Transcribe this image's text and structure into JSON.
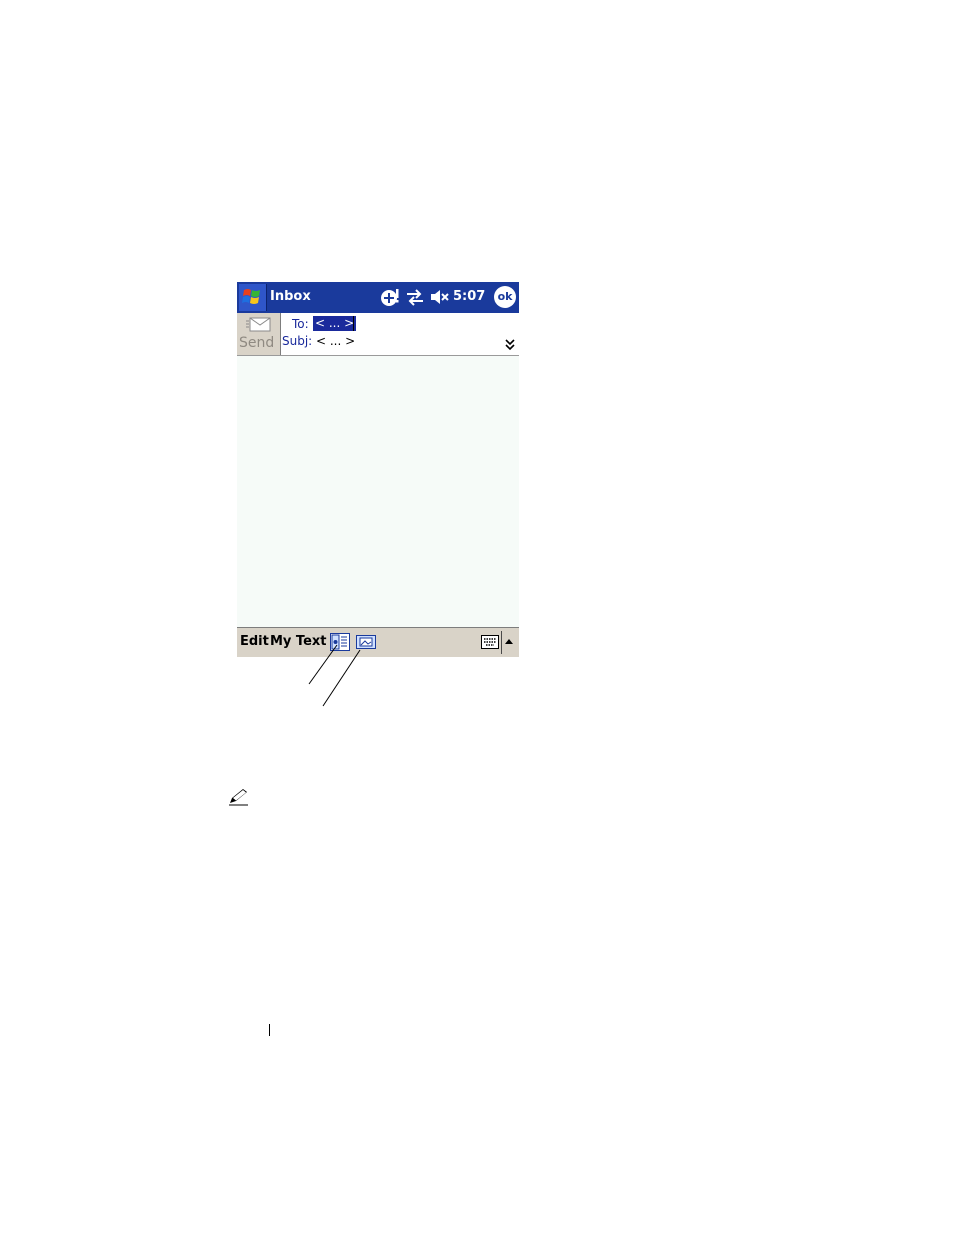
{
  "window": {
    "title": "Inbox",
    "time": "5:07",
    "ok_label": "ok"
  },
  "compose": {
    "send_label": "Send",
    "to_label": "To:",
    "to_value": "< ... >",
    "subj_label": "Subj:",
    "subj_value": "< ... >"
  },
  "menubar": {
    "edit_label": "Edit",
    "mytext_label": "My Text"
  },
  "icons": {
    "start": "windows-flag-icon",
    "status": [
      "new-message-icon",
      "connectivity-icon",
      "speaker-muted-icon"
    ],
    "toolbar": [
      "insert-recording-icon",
      "insert-picture-icon",
      "keyboard-icon"
    ]
  },
  "colors": {
    "titlebar": "#1a3a9c",
    "menubar": "#d9d3c8",
    "body": "#f6fbf8",
    "selection": "#1a2a9c"
  }
}
